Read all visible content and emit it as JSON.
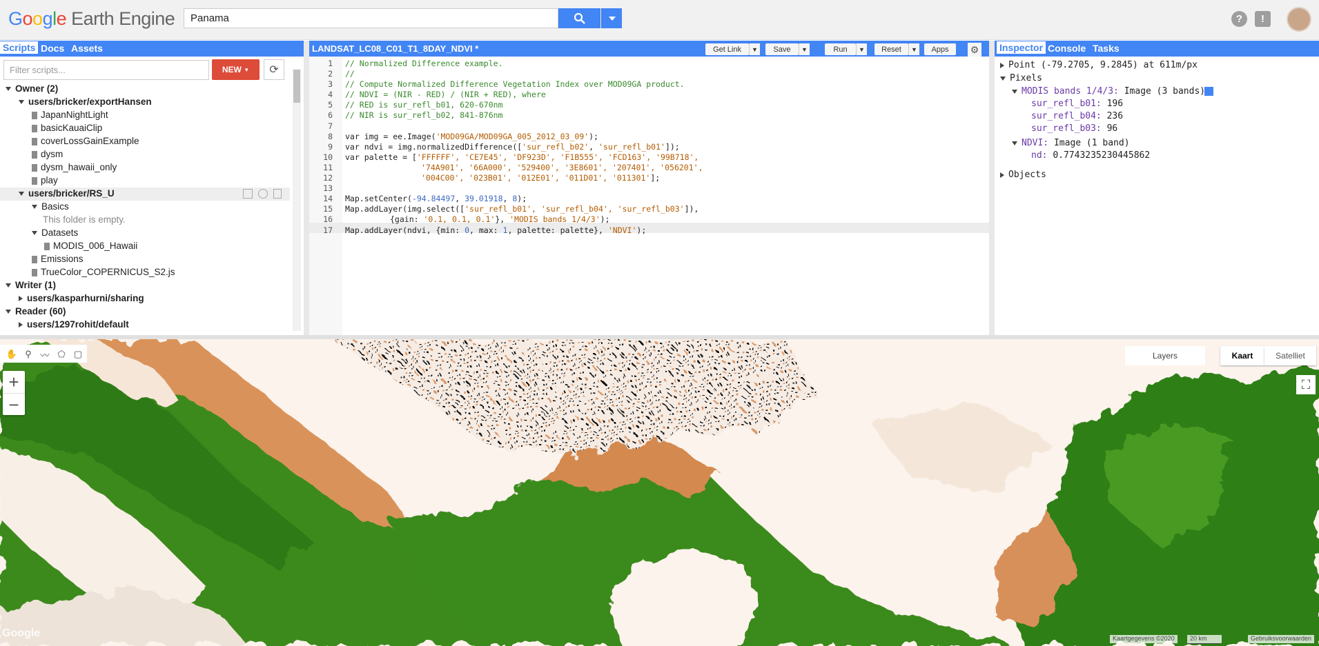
{
  "header": {
    "logo_google": "Google",
    "logo_product": "Earth Engine",
    "search_value": "Panama"
  },
  "left_panel": {
    "tabs": [
      "Scripts",
      "Docs",
      "Assets"
    ],
    "filter_placeholder": "Filter scripts...",
    "new_label": "NEW",
    "tree": {
      "owner": "Owner",
      "owner_count": "(2)",
      "repo1": "users/bricker/exportHansen",
      "files1": [
        "JapanNightLight",
        "basicKauaiClip",
        "coverLossGainExample",
        "dysm",
        "dysm_hawaii_only",
        "play"
      ],
      "repo2": "users/bricker/RS_U",
      "basics": "Basics",
      "empty": "This folder is empty.",
      "datasets": "Datasets",
      "modis": "MODIS_006_Hawaii",
      "emissions": "Emissions",
      "truecolor": "TrueColor_COPERNICUS_S2.js",
      "writer": "Writer",
      "writer_count": "(1)",
      "writer_repo": "users/kasparhurni/sharing",
      "reader": "Reader",
      "reader_count": "(60)",
      "reader_repo": "users/1297rohit/default"
    }
  },
  "editor": {
    "title": "LANDSAT_LC08_C01_T1_8DAY_NDVI *",
    "buttons": {
      "get_link": "Get Link",
      "save": "Save",
      "run": "Run",
      "reset": "Reset",
      "apps": "Apps"
    },
    "line_numbers": [
      "1",
      "2",
      "3",
      "4",
      "5",
      "6",
      "7",
      "8",
      "9",
      "10",
      "11",
      "12",
      "13",
      "14",
      "15",
      "16",
      "17"
    ],
    "code": {
      "l1": "// Normalized Difference example.",
      "l2": "//",
      "l3": "// Compute Normalized Difference Vegetation Index over MOD09GA product.",
      "l4": "// NDVI = (NIR - RED) / (NIR + RED), where",
      "l5": "// RED is sur_refl_b01, 620-670nm",
      "l6": "// NIR is sur_refl_b02, 841-876nm",
      "l8a": "var img = ee.Image(",
      "l8b": "'MOD09GA/MOD09GA_005_2012_03_09'",
      "l8c": ");",
      "l9a": "var ndvi = img.normalizedDifference([",
      "l9b": "'sur_refl_b02'",
      "l9c": ", ",
      "l9d": "'sur_refl_b01'",
      "l9e": "]);",
      "l10a": "var palette = [",
      "l10b": "'FFFFFF', 'CE7E45', 'DF923D', 'F1B555', 'FCD163', '99B718',",
      "l11": "'74A901', '66A000', '529400', '3E8601', '207401', '056201',",
      "l12a": "'004C00', '023B01', '012E01', '011D01', '011301'",
      "l12b": "];",
      "l14a": "Map.setCenter(",
      "l14b": "-94.84497",
      "l14c": ", ",
      "l14d": "39.01918",
      "l14e": ", ",
      "l14f": "8",
      "l14g": ");",
      "l15a": "Map.addLayer(img.select([",
      "l15b": "'sur_refl_b01', 'sur_refl_b04', 'sur_refl_b03'",
      "l15c": "]),",
      "l16a": "{gain: ",
      "l16b": "'0.1, 0.1, 0.1'",
      "l16c": "}, ",
      "l16d": "'MODIS bands 1/4/3'",
      "l16e": ");",
      "l17a": "Map.addLayer(ndvi, {min: ",
      "l17b": "0",
      "l17c": ", max: ",
      "l17d": "1",
      "l17e": ", palette: palette}, ",
      "l17f": "'NDVI'",
      "l17g": ");"
    }
  },
  "right_panel": {
    "tabs": [
      "Inspector",
      "Console",
      "Tasks"
    ],
    "point": "Point (-79.2705, 9.2845) at 611m/px",
    "pixels": "Pixels",
    "modis_layer": "MODIS bands 1/4/3:",
    "modis_desc": "Image (3 bands)",
    "bands": [
      {
        "name": "sur_refl_b01:",
        "value": "196"
      },
      {
        "name": "sur_refl_b04:",
        "value": "236"
      },
      {
        "name": "sur_refl_b03:",
        "value": "96"
      }
    ],
    "ndvi_layer": "NDVI:",
    "ndvi_desc": "Image (1 band)",
    "nd_name": "nd:",
    "nd_value": "0.7743235230445862",
    "objects": "Objects"
  },
  "map": {
    "layers_label": "Layers",
    "kaart_label": "Kaart",
    "satelliet_label": "Satelliet",
    "watermark": "Google",
    "attribution": "Kaartgegevens ©2020",
    "scale": "20 km",
    "terms": "Gebruiksvoorwaarden"
  },
  "colors": {
    "accent": "#4285f4",
    "new_button": "#dd4b39"
  }
}
